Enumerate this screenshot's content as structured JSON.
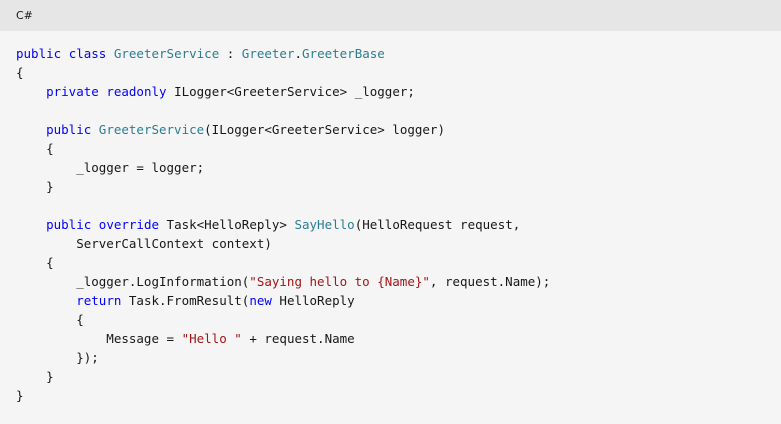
{
  "header": {
    "language_label": "C#"
  },
  "code": {
    "lines": [
      [
        {
          "k": "kw",
          "t": "public"
        },
        {
          "k": "pl",
          "t": " "
        },
        {
          "k": "kw",
          "t": "class"
        },
        {
          "k": "pl",
          "t": " "
        },
        {
          "k": "ty",
          "t": "GreeterService"
        },
        {
          "k": "pl",
          "t": " : "
        },
        {
          "k": "ty",
          "t": "Greeter"
        },
        {
          "k": "pl",
          "t": "."
        },
        {
          "k": "ty",
          "t": "GreeterBase"
        }
      ],
      [
        {
          "k": "pl",
          "t": "{"
        }
      ],
      [
        {
          "k": "pl",
          "t": "    "
        },
        {
          "k": "kw",
          "t": "private"
        },
        {
          "k": "pl",
          "t": " "
        },
        {
          "k": "kw",
          "t": "readonly"
        },
        {
          "k": "pl",
          "t": " ILogger<GreeterService> _logger;"
        }
      ],
      [],
      [
        {
          "k": "pl",
          "t": "    "
        },
        {
          "k": "kw",
          "t": "public"
        },
        {
          "k": "pl",
          "t": " "
        },
        {
          "k": "ty",
          "t": "GreeterService"
        },
        {
          "k": "pl",
          "t": "(ILogger<GreeterService> logger)"
        }
      ],
      [
        {
          "k": "pl",
          "t": "    {"
        }
      ],
      [
        {
          "k": "pl",
          "t": "        _logger = logger;"
        }
      ],
      [
        {
          "k": "pl",
          "t": "    }"
        }
      ],
      [],
      [
        {
          "k": "pl",
          "t": "    "
        },
        {
          "k": "kw",
          "t": "public"
        },
        {
          "k": "pl",
          "t": " "
        },
        {
          "k": "kw",
          "t": "override"
        },
        {
          "k": "pl",
          "t": " Task<HelloReply> "
        },
        {
          "k": "ty",
          "t": "SayHello"
        },
        {
          "k": "pl",
          "t": "(HelloRequest request,"
        }
      ],
      [
        {
          "k": "pl",
          "t": "        ServerCallContext context)"
        }
      ],
      [
        {
          "k": "pl",
          "t": "    {"
        }
      ],
      [
        {
          "k": "pl",
          "t": "        _logger.LogInformation("
        },
        {
          "k": "st",
          "t": "\"Saying hello to {Name}\""
        },
        {
          "k": "pl",
          "t": ", request.Name);"
        }
      ],
      [
        {
          "k": "pl",
          "t": "        "
        },
        {
          "k": "kw",
          "t": "return"
        },
        {
          "k": "pl",
          "t": " Task.FromResult("
        },
        {
          "k": "kw",
          "t": "new"
        },
        {
          "k": "pl",
          "t": " HelloReply"
        }
      ],
      [
        {
          "k": "pl",
          "t": "        {"
        }
      ],
      [
        {
          "k": "pl",
          "t": "            Message = "
        },
        {
          "k": "st",
          "t": "\"Hello \""
        },
        {
          "k": "pl",
          "t": " + request.Name"
        }
      ],
      [
        {
          "k": "pl",
          "t": "        });"
        }
      ],
      [
        {
          "k": "pl",
          "t": "    }"
        }
      ],
      [
        {
          "k": "pl",
          "t": "}"
        }
      ]
    ]
  },
  "colors": {
    "keyword": "#0101fd",
    "type": "#2b7d91",
    "string": "#a31515",
    "plain": "#171717",
    "header_bg": "#e6e6e6",
    "code_bg": "#f5f5f5"
  }
}
